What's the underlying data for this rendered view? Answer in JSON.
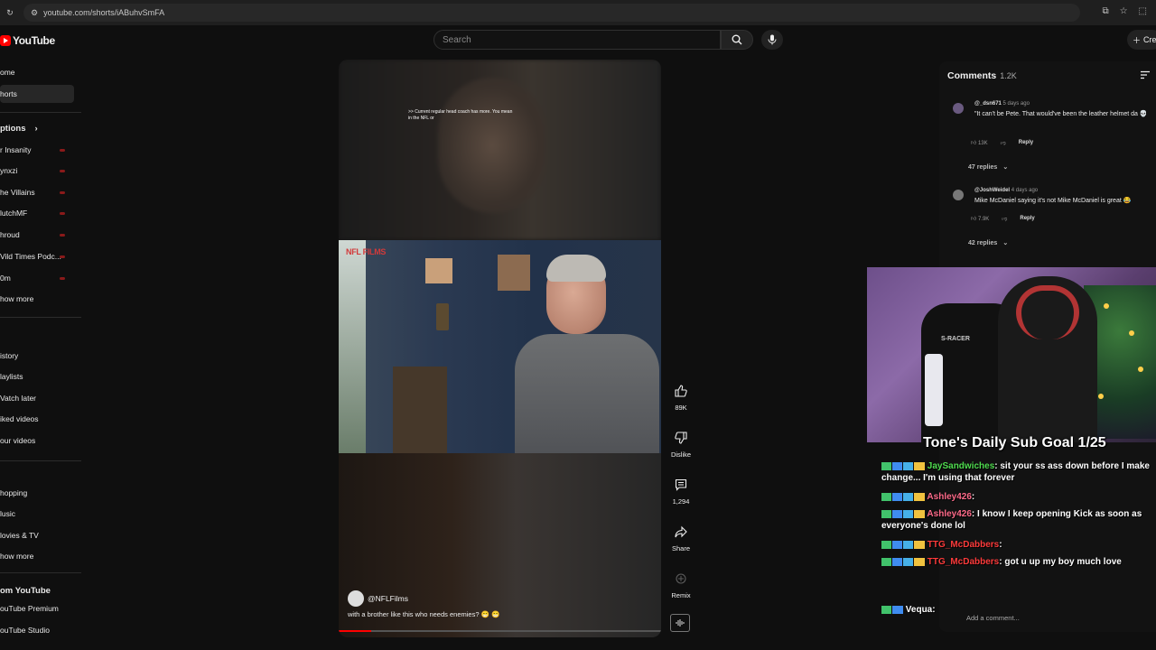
{
  "browser": {
    "url": "youtube.com/shorts/iABuhvSmFA"
  },
  "header": {
    "logo_text": "YouTube",
    "search_placeholder": "Search",
    "create_label": "Cre"
  },
  "sidebar": {
    "items": [
      {
        "label": "ome",
        "active": false
      },
      {
        "label": "horts",
        "active": true
      },
      {
        "label": "ptions",
        "section": true
      },
      {
        "label": "r Insanity",
        "live": true
      },
      {
        "label": "ynxzi",
        "live": true
      },
      {
        "label": "he Villains",
        "live": true
      },
      {
        "label": "lutchMF",
        "live": true
      },
      {
        "label": "hroud",
        "live": true
      },
      {
        "label": "Vild Times Podc...",
        "live": true
      },
      {
        "label": "0m",
        "live": true
      },
      {
        "label": "how more"
      },
      {
        "label": "istory"
      },
      {
        "label": "laylists"
      },
      {
        "label": "Vatch later"
      },
      {
        "label": "iked videos"
      },
      {
        "label": "our videos"
      },
      {
        "label": "hopping"
      },
      {
        "label": "lusic"
      },
      {
        "label": "lovies & TV"
      },
      {
        "label": "how more"
      },
      {
        "label": "om YouTube",
        "section": true
      },
      {
        "label": "ouTube Premium"
      },
      {
        "label": "ouTube Studio"
      }
    ]
  },
  "video": {
    "caption_top": ">> Current regular head coach has more. You mean in the NFL or",
    "badge": "NFL FILMS",
    "channel": "@NFLFilms",
    "description": "with a brother like this who needs enemies? 😁 😁",
    "progress": 0.1
  },
  "actions": {
    "like_count": "89K",
    "dislike_label": "Dislike",
    "comment_count": "1,294",
    "share_label": "Share",
    "remix_label": "Remix"
  },
  "comments": {
    "title": "Comments",
    "count": "1.2K",
    "list": [
      {
        "user": "@_dsn671",
        "time": "5 days ago",
        "text": "\"It can't be Pete. That would've been the leather helmet da 💀",
        "likes": "13K",
        "reply": "Reply",
        "replies": "47 replies"
      },
      {
        "user": "@JoshWeidel",
        "time": "4 days ago",
        "text": "Mike McDaniel saying it's not Mike McDaniel is great 😂",
        "likes": "7.9K",
        "reply": "Reply",
        "replies": "42 replies"
      }
    ],
    "add_placeholder": "Add a comment..."
  },
  "overlay": {
    "goal_text": "Tone's Daily Sub Goal 1/25",
    "cam_brand": "S-RACER",
    "chat": [
      {
        "user": "JaySandwiches",
        "color": "#4fdc4f",
        "msg": ": sit your ss ass down before I make change... I'm using that forever"
      },
      {
        "user": "Ashley426",
        "color": "#ff6b8a",
        "msg": ":"
      },
      {
        "user": "Ashley426",
        "color": "#ff6b8a",
        "msg": ": I know I keep opening Kick as soon as everyone's done lol"
      },
      {
        "user": "TTG_McDabbers",
        "color": "#ff3b3b",
        "msg": ":"
      },
      {
        "user": "TTG_McDabbers",
        "color": "#ff3b3b",
        "msg": ": got u up my boy much love"
      },
      {
        "user": "Vequa",
        "color": "#ffffff",
        "msg": ":"
      }
    ]
  }
}
